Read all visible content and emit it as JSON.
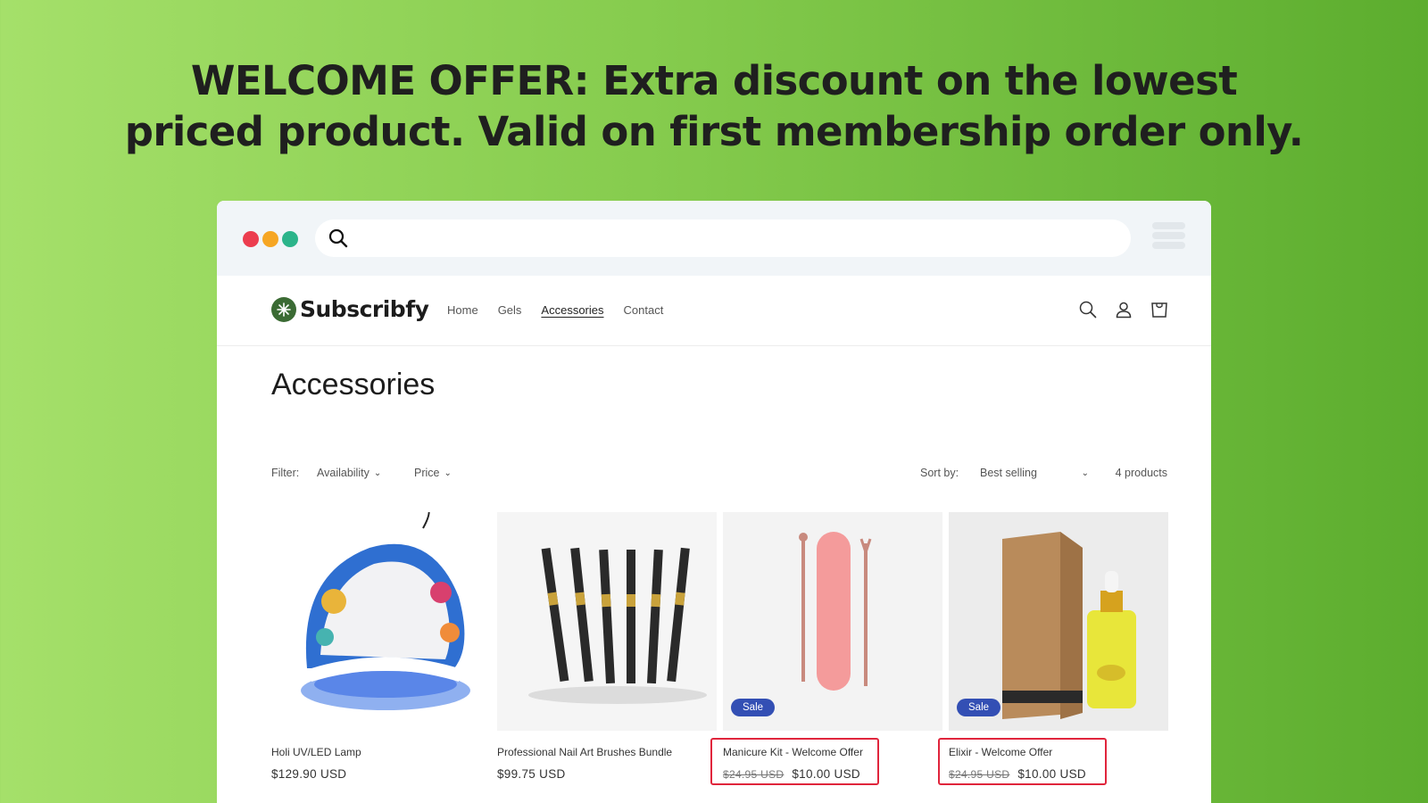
{
  "banner": {
    "line1": "WELCOME OFFER: Extra discount on the lowest",
    "line2": "priced product. Valid on first membership order only."
  },
  "browser": {
    "dot_colors": [
      "#ec3d4f",
      "#f6a623",
      "#2bb48a"
    ],
    "url": ""
  },
  "store": {
    "brand": "Subscribfy",
    "brand_color": "#3b6b34",
    "nav": [
      {
        "label": "Home",
        "active": false
      },
      {
        "label": "Gels",
        "active": false
      },
      {
        "label": "Accessories",
        "active": true
      },
      {
        "label": "Contact",
        "active": false
      }
    ],
    "icons": [
      "search-icon",
      "account-icon",
      "cart-icon"
    ]
  },
  "collection": {
    "title": "Accessories",
    "filter_label": "Filter:",
    "filters": [
      "Availability",
      "Price"
    ],
    "sort_label": "Sort by:",
    "sort_value": "Best selling",
    "count": "4 products"
  },
  "products": [
    {
      "name": "Holi UV/LED Lamp",
      "compare_price": "",
      "price": "$129.90 USD",
      "sale": false,
      "badge": "",
      "highlighted": false
    },
    {
      "name": "Professional Nail Art Brushes Bundle",
      "compare_price": "",
      "price": "$99.75 USD",
      "sale": false,
      "badge": "",
      "highlighted": false
    },
    {
      "name": "Manicure Kit - Welcome Offer",
      "compare_price": "$24.95 USD",
      "price": "$10.00 USD",
      "sale": true,
      "badge": "Sale",
      "highlighted": true
    },
    {
      "name": "Elixir - Welcome Offer",
      "compare_price": "$24.95 USD",
      "price": "$10.00 USD",
      "sale": true,
      "badge": "Sale",
      "highlighted": true
    }
  ],
  "colors": {
    "sale_badge": "#334fb4",
    "highlight_border": "#e0253c"
  }
}
